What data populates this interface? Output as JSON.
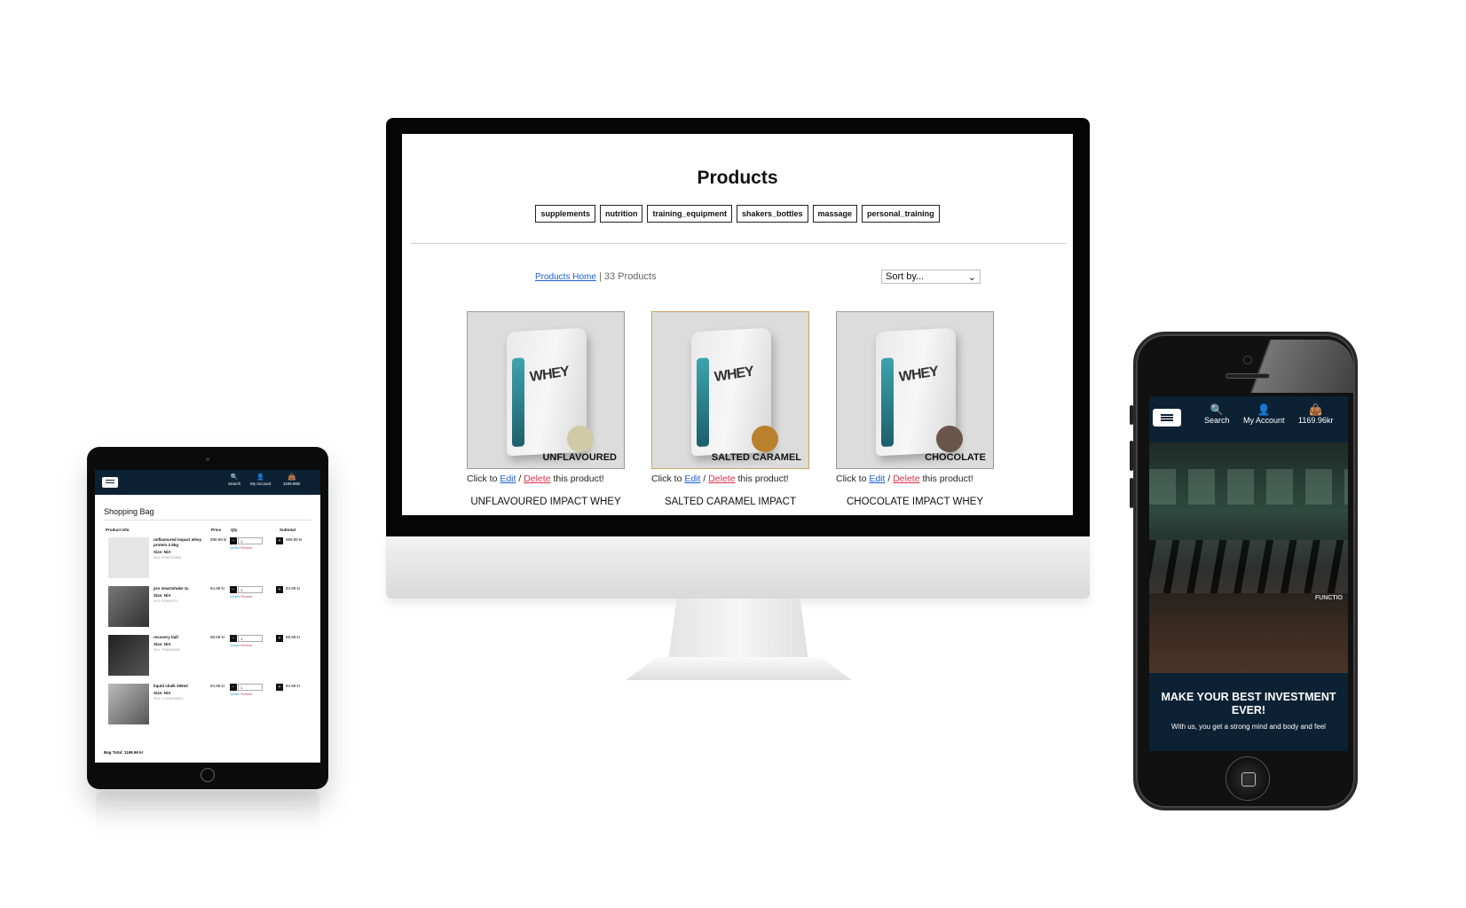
{
  "desktop": {
    "title": "Products",
    "categories": [
      "supplements",
      "nutrition",
      "training_equipment",
      "shakers_bottles",
      "massage",
      "personal_training"
    ],
    "breadcrumb_link": "Products Home",
    "breadcrumb_count": "| 33 Products",
    "sort_label": "Sort by...",
    "sort_arrow": "⌄",
    "click_prefix": "Click to ",
    "edit_label": "Edit",
    "separator": " / ",
    "delete_label": "Delete",
    "click_suffix": " this product!",
    "products": [
      {
        "flavour": "UNFLAVOURED",
        "name": "UNFLAVOURED IMPACT WHEY",
        "dot_color": "#cfc9a8"
      },
      {
        "flavour": "SALTED CARAMEL",
        "name": "SALTED CARAMEL IMPACT",
        "dot_color": "#b9802d"
      },
      {
        "flavour": "CHOCOLATE",
        "name": "CHOCOLATE IMPACT WHEY",
        "dot_color": "#6b5449"
      }
    ],
    "bag_word": "WHEY"
  },
  "tablet": {
    "nav": {
      "search": "Search",
      "account": "My Account",
      "bag": "1169.96kr"
    },
    "heading": "Shopping Bag",
    "columns": {
      "info": "Product Info",
      "price": "Price",
      "qty": "Qty",
      "subtotal": "Subtotal"
    },
    "update": "Update",
    "remove": "Remove",
    "items": [
      {
        "name": "unflavoured impact whey protein 2.5kg",
        "size": "Size: N/A",
        "sku": "SKU: IP9527043RU",
        "price": "899.99 kr",
        "qty": "1",
        "subtotal": "899.99 kr"
      },
      {
        "name": "pro smartshake 1L",
        "size": "Size: N/A",
        "sku": "SKU: PS8367072",
        "price": "84.99 kr",
        "qty": "1",
        "subtotal": "84.99 kr"
      },
      {
        "name": "recovery ball",
        "size": "Size: N/A",
        "sku": "SKU: TR80320018",
        "price": "89.99 kr",
        "qty": "1",
        "subtotal": "89.99 kr"
      },
      {
        "name": "liquid chalk 250ml",
        "size": "Size: N/A",
        "sku": "SKU: LC3780035891",
        "price": "94.99 kr",
        "qty": "1",
        "subtotal": "94.99 kr"
      }
    ],
    "total": "Bag Total: 1169.96 kr"
  },
  "phone": {
    "nav": {
      "search": "Search",
      "account": "My Account",
      "bag": "1169.96kr"
    },
    "hero_brand": "FUNCTIO",
    "headline": "MAKE YOUR BEST INVESTMENT EVER!",
    "subline": "With us, you get a strong mind and body and feel"
  },
  "icons": {
    "search": "🔍",
    "account": "👤",
    "bag": "👜",
    "minus": "−",
    "plus": "+"
  }
}
